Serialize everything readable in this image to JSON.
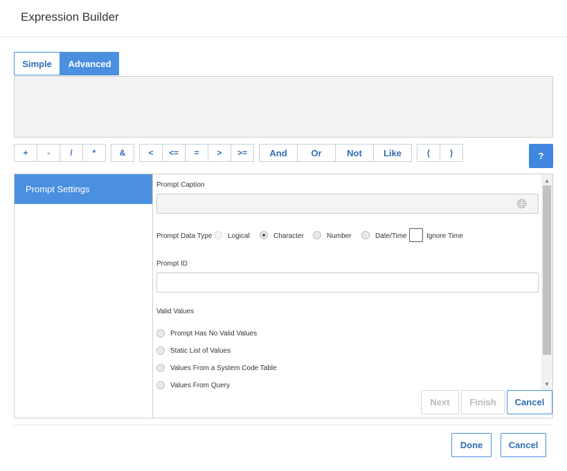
{
  "dialog": {
    "title": "Expression Builder"
  },
  "mode_tabs": {
    "simple": "Simple",
    "advanced": "Advanced",
    "selected": "Advanced"
  },
  "operators": {
    "plus": "+",
    "minus": "-",
    "divide": "/",
    "multiply": "*",
    "concat": "&",
    "lt": "<",
    "lte": "<=",
    "eq": "=",
    "gt": ">",
    "gte": ">=",
    "and": "And",
    "or": "Or",
    "not": "Not",
    "like": "Like",
    "open_paren": "(",
    "close_paren": ")",
    "help": "?"
  },
  "sidebar": {
    "items": [
      {
        "label": "Prompt Settings",
        "active": true
      }
    ]
  },
  "prompt": {
    "caption_label": "Prompt Caption",
    "caption_value": "",
    "globe_icon": "globe-icon",
    "data_type_label": "Prompt Data Type",
    "data_types": [
      {
        "label": "Logical",
        "checked": false,
        "disabled": true
      },
      {
        "label": "Character",
        "checked": true,
        "disabled": false
      },
      {
        "label": "Number",
        "checked": false,
        "disabled": false
      },
      {
        "label": "Date/Time",
        "checked": false,
        "disabled": false
      }
    ],
    "ignore_time_label": "Ignore Time",
    "ignore_time_checked": false,
    "id_label": "Prompt ID",
    "id_value": "",
    "valid_values_label": "Valid Values",
    "valid_values_options": [
      {
        "label": "Prompt Has No Valid Values",
        "checked": false
      },
      {
        "label": "Static List of Values",
        "checked": false
      },
      {
        "label": "Values From a System Code Table",
        "checked": false
      },
      {
        "label": "Values From Query",
        "checked": false
      }
    ]
  },
  "wizard_buttons": {
    "next": "Next",
    "finish": "Finish",
    "cancel": "Cancel"
  },
  "footer": {
    "done": "Done",
    "cancel": "Cancel"
  },
  "colors": {
    "accent": "#4a8fe0",
    "accent_text": "#2f6db5",
    "help_button": "#3f86de"
  }
}
